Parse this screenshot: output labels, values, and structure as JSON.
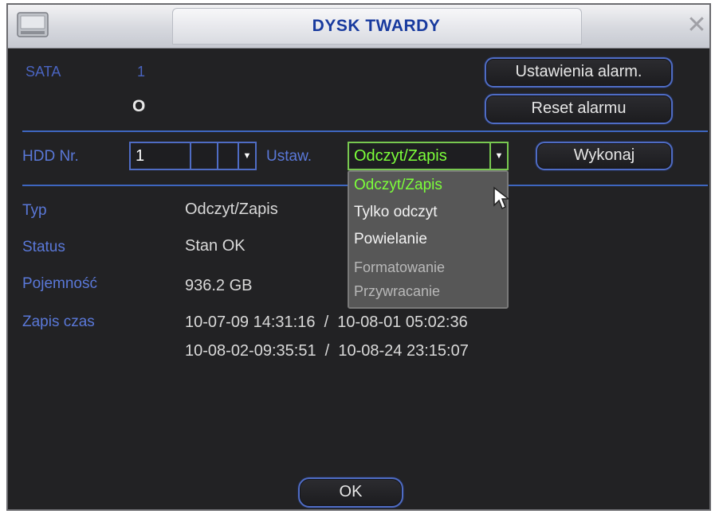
{
  "window": {
    "title": "DYSK TWARDY",
    "icon": "hdd-icon",
    "close_icon": "close-icon"
  },
  "sata": {
    "label": "SATA",
    "number": "1",
    "status_symbol": "O"
  },
  "buttons": {
    "alarm_settings": "Ustawienia alarm.",
    "reset_alarm": "Reset alarmu",
    "execute": "Wykonaj",
    "ok": "OK"
  },
  "controls": {
    "hdd_label": "HDD Nr.",
    "hdd_value": "1",
    "set_label": "Ustaw.",
    "set_value": "Odczyt/Zapis"
  },
  "dropdown": {
    "options": [
      {
        "label": "Odczyt/Zapis",
        "state": "highlighted"
      },
      {
        "label": "Tylko odczyt",
        "state": "enabled"
      },
      {
        "label": "Powielanie",
        "state": "enabled"
      },
      {
        "label": "Formatowanie",
        "state": "disabled"
      },
      {
        "label": "Przywracanie",
        "state": "disabled"
      }
    ]
  },
  "info": {
    "type_label": "Typ",
    "type_value": "Odczyt/Zapis",
    "status_label": "Status",
    "status_value": "Stan OK",
    "capacity_label": "Pojemność",
    "capacity_value": "936.2 GB",
    "record_label": "Zapis czas",
    "record_lines": [
      "10-07-09 14:31:16  /  10-08-01 05:02:36",
      "10-08-02-09:35:51  /  10-08-24 23:15:07"
    ]
  },
  "colors": {
    "accent_blue": "#4f6cc4",
    "label_blue": "#5a78d8",
    "highlight_green": "#7cff3a",
    "title_blue": "#183a9e",
    "background": "#222224"
  }
}
